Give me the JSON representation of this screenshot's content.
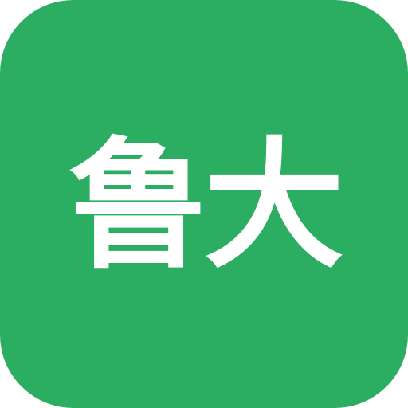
{
  "icon": {
    "label": "鲁大",
    "background_color": "#2bae62",
    "text_color": "#ffffff"
  }
}
